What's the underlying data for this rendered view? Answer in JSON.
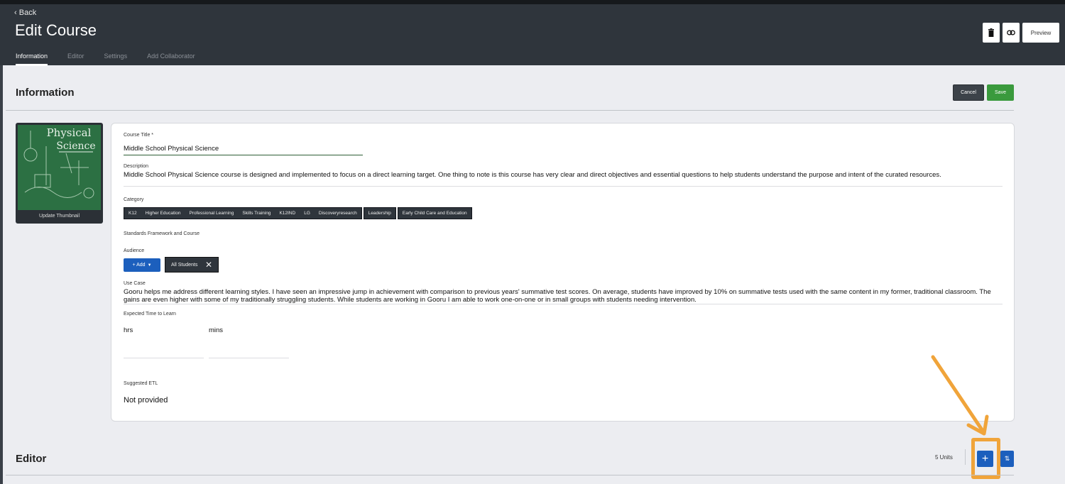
{
  "header": {
    "back_label": "Back",
    "title": "Edit Course",
    "tabs": [
      {
        "label": "Information",
        "active": true
      },
      {
        "label": "Editor"
      },
      {
        "label": "Settings"
      },
      {
        "label": "Add Collaborator"
      }
    ],
    "actions": {
      "delete_icon": "trash-icon",
      "link_icon": "link-icon",
      "preview_label": "Preview"
    }
  },
  "information": {
    "section_title": "Information",
    "cancel_label": "Cancel",
    "save_label": "Save",
    "thumbnail": {
      "image_text_line1": "Physical",
      "image_text_line2": "Science",
      "update_label": "Update Thumbnail"
    },
    "form": {
      "course_title_label": "Course Title *",
      "course_title_value": "Middle School Physical Science",
      "description_label": "Description",
      "description_value": "Middle School Physical Science course is designed and implemented to focus on a direct learning target. One thing to note is this course has very clear and direct objectives and essential questions to help students understand the purpose and intent of the curated resources.",
      "category_label": "Category",
      "categories": {
        "group_main": [
          "K12",
          "Higher Education",
          "Professional Learning",
          "Skills Training",
          "K12IND",
          "LG",
          "Discoveryresearch"
        ],
        "leadership": "Leadership",
        "early_child": "Early Child Care and Education"
      },
      "standards_label": "Standards Framework and Course",
      "audience_label": "Audience",
      "audience_add_label": "+ Add",
      "audience_selected": "All Students",
      "use_case_label": "Use Case",
      "use_case_value": "Gooru helps me address different learning styles. I have seen an impressive jump in achievement with comparison to previous years' summative test scores. On average, students have improved by 10% on summative tests used with the same content in my former, traditional classroom. The gains are even higher with some of my traditionally struggling students. While students are working in Gooru I am able to work one-on-one or in small groups with students needing intervention.",
      "expected_time_label": "Expected Time to Learn",
      "hrs_label": "hrs",
      "mins_label": "mins",
      "suggested_etl_label": "Suggested ETL",
      "suggested_etl_value": "Not provided"
    }
  },
  "editor": {
    "section_title": "Editor",
    "units_label": "5 Units",
    "add_icon": "plus-icon",
    "reorder_icon": "reorder-icon",
    "highlight_color": "#f0a43a"
  },
  "colors": {
    "header_bg": "#2f353c",
    "primary_blue": "#1c5fbd",
    "save_green": "#3a9a3d"
  }
}
